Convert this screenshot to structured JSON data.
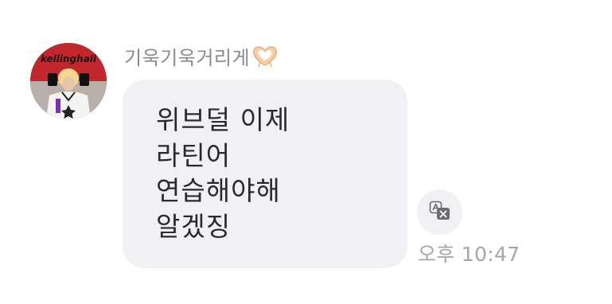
{
  "message": {
    "sender_name": "기욱기욱거리게",
    "sender_emoji_icon": "heart-hands-icon",
    "lines": [
      "위브덜 이제",
      "라틴어",
      "연습해야해",
      "알겠징"
    ],
    "timestamp": "오후 10:47",
    "avatar_logo_text": "kellinghall",
    "translate_icon": "translate-icon"
  },
  "colors": {
    "bubble_bg": "#f1f1f4",
    "sender_text": "#8a8a8f",
    "message_text": "#2a2a2e",
    "timestamp_text": "#a5a5ab",
    "avatar_bg": "#c2272d"
  }
}
